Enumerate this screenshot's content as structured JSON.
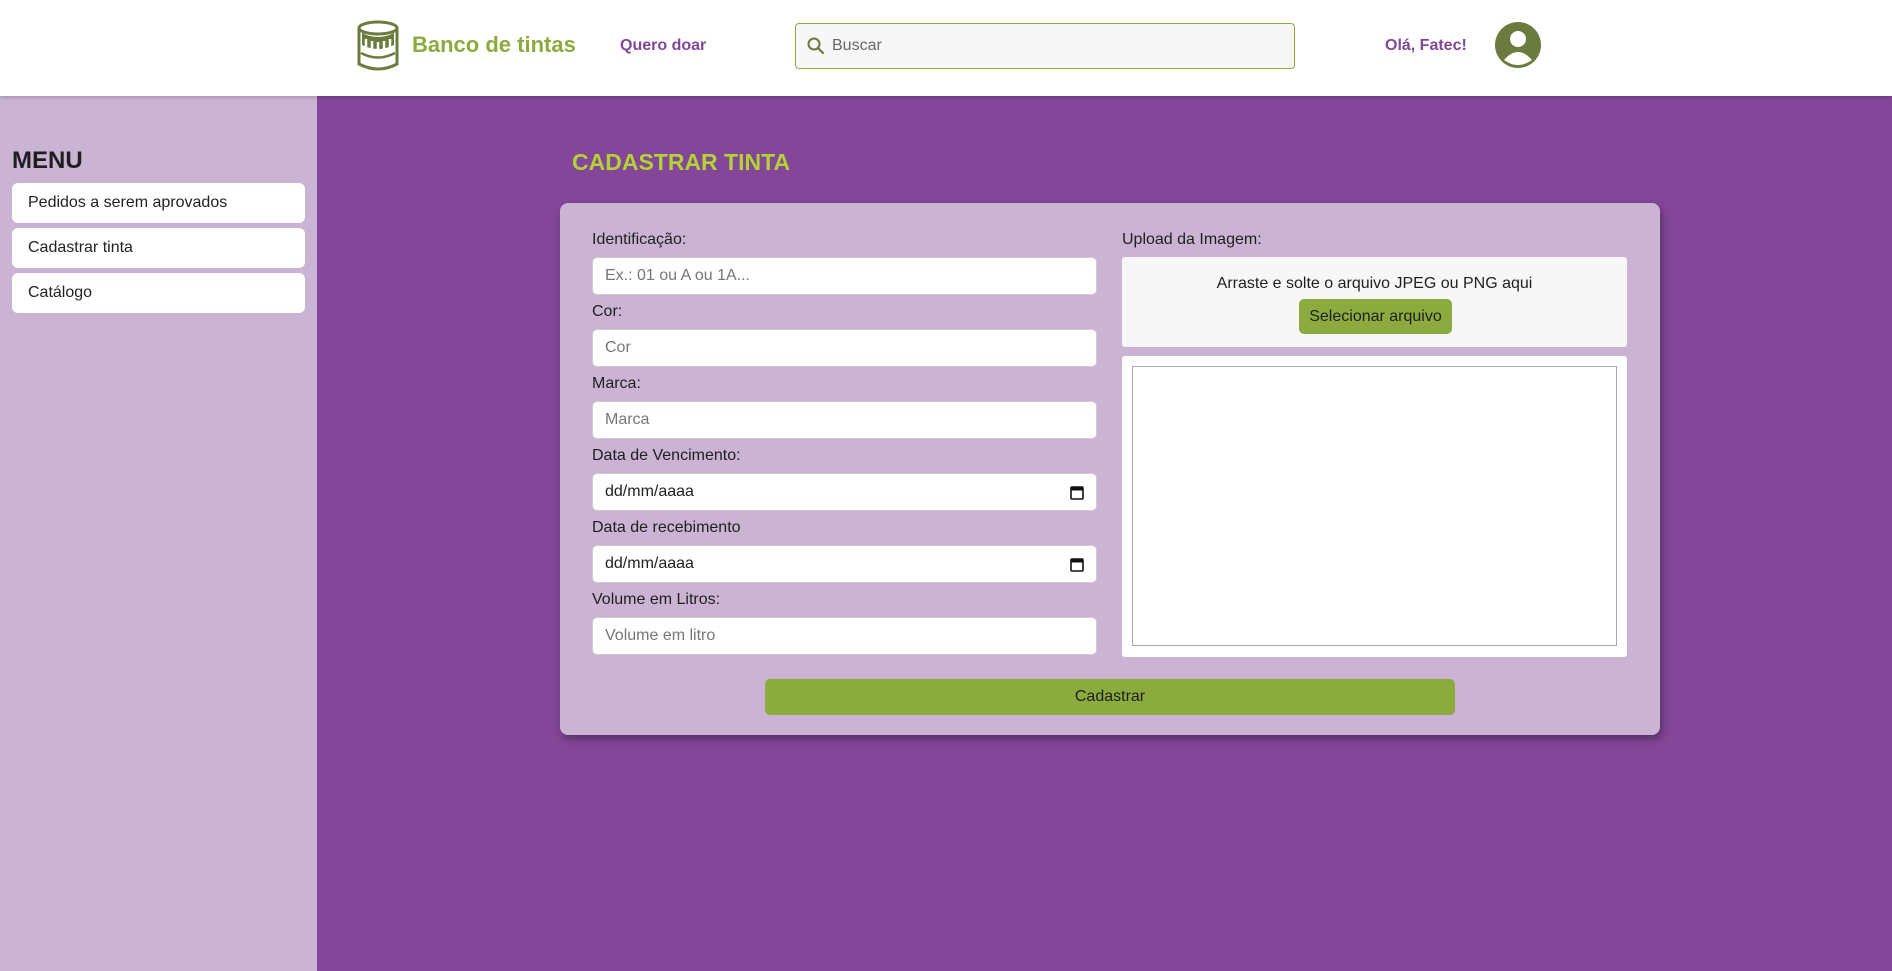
{
  "header": {
    "brand": "Banco de tintas",
    "donate_link": "Quero doar",
    "search_placeholder": "Buscar",
    "greeting": "Olá, Fatec!",
    "logo_icon": "paint-can-icon",
    "avatar_icon": "user-avatar-icon"
  },
  "sidebar": {
    "title": "MENU",
    "items": [
      {
        "label": "Pedidos a serem aprovados"
      },
      {
        "label": "Cadastrar tinta"
      },
      {
        "label": "Catálogo"
      }
    ]
  },
  "main": {
    "title": "CADASTRAR TINTA",
    "form": {
      "identificacao_label": "Identificação:",
      "identificacao_placeholder": "Ex.: 01 ou A ou 1A...",
      "cor_label": "Cor:",
      "cor_placeholder": "Cor",
      "marca_label": "Marca:",
      "marca_placeholder": "Marca",
      "vencimento_label": "Data de Vencimento:",
      "vencimento_value": "dd/mm/aaaa",
      "recebimento_label": "Data de recebimento",
      "recebimento_value": "dd/mm/aaaa",
      "volume_label": "Volume em Litros:",
      "volume_placeholder": "Volume em litro",
      "upload_label": "Upload da Imagem:",
      "drop_text": "Arraste e solte o arquivo JPEG ou PNG aqui",
      "select_file": "Selecionar arquivo",
      "submit": "Cadastrar"
    }
  },
  "colors": {
    "brand_green": "#8bab3f",
    "purple": "#834699",
    "light_purple": "#cbb3d4",
    "title_lime": "#b3d234"
  }
}
